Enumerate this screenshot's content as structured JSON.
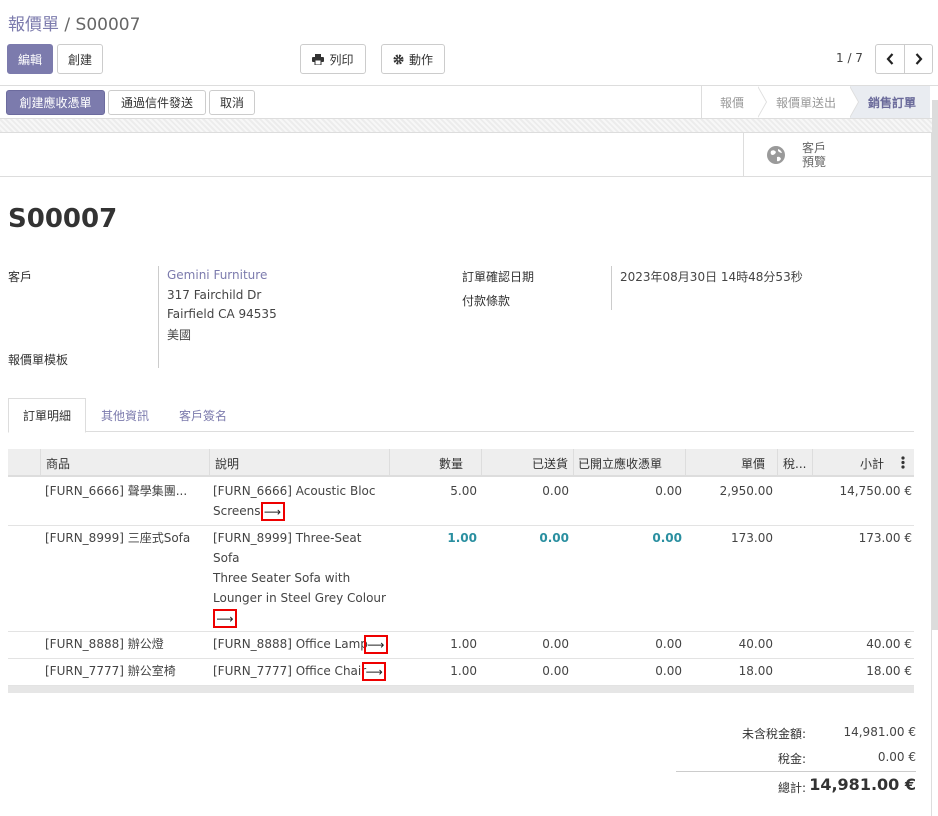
{
  "breadcrumb": {
    "parent": "報價單",
    "separator": "/",
    "current": "S00007"
  },
  "toolbar": {
    "edit": "編輯",
    "create": "創建",
    "print": "列印",
    "action": "動作"
  },
  "pager": {
    "value": "1 / 7"
  },
  "status_buttons": {
    "create_invoice": "創建應收憑單",
    "send_email": "通過信件發送",
    "cancel": "取消"
  },
  "stages": [
    "報價",
    "報價單送出",
    "銷售訂單"
  ],
  "smart_button": {
    "line1": "客戶",
    "line2": "預覽"
  },
  "order": {
    "name": "S00007",
    "customer_label": "客戶",
    "customer_name": "Gemini Furniture",
    "address": [
      "317 Fairchild Dr",
      "Fairfield CA 94535",
      "美國"
    ],
    "template_label": "報價單模板",
    "confirm_date_label": "訂單確認日期",
    "confirm_date": "2023年08月30日 14時48分53秒",
    "payment_terms_label": "付款條款"
  },
  "tabs": [
    "訂單明細",
    "其他資訊",
    "客戶簽名"
  ],
  "table": {
    "headers": [
      "商品",
      "說明",
      "數量",
      "已送貨",
      "已開立應收憑單",
      "單價",
      "稅...",
      "小計"
    ],
    "rows": [
      {
        "product": "[FURN_6666] 聲學集團...",
        "desc": [
          "[FURN_6666] Acoustic Bloc",
          "Screens"
        ],
        "qty": "5.00",
        "delivered": "0.00",
        "invoiced": "0.00",
        "price": "2,950.00",
        "subtotal": "14,750.00 €"
      },
      {
        "product": "[FURN_8999] 三座式Sofa",
        "desc": [
          "[FURN_8999] Three-Seat",
          "Sofa",
          "Three Seater Sofa with",
          "Lounger in Steel Grey Colour"
        ],
        "qty": "1.00",
        "delivered": "0.00",
        "invoiced": "0.00",
        "price": "173.00",
        "subtotal": "173.00 €"
      },
      {
        "product": "[FURN_8888] 辦公燈",
        "desc": [
          "[FURN_8888] Office Lamp"
        ],
        "qty": "1.00",
        "delivered": "0.00",
        "invoiced": "0.00",
        "price": "40.00",
        "subtotal": "40.00 €"
      },
      {
        "product": "[FURN_7777] 辦公室椅",
        "desc": [
          "[FURN_7777] Office Chair"
        ],
        "qty": "1.00",
        "delivered": "0.00",
        "invoiced": "0.00",
        "price": "18.00",
        "subtotal": "18.00 €"
      }
    ]
  },
  "totals": {
    "untaxed_label": "未含稅金額:",
    "untaxed": "14,981.00 €",
    "tax_label": "稅金:",
    "tax": "0.00 €",
    "total_label": "總計:",
    "total": "14,981.00 €"
  },
  "arrow_glyph": "⟶",
  "colors": {
    "primary": "#7c7bad",
    "highlight": "#2a8fa0",
    "marker": "#e00000"
  }
}
